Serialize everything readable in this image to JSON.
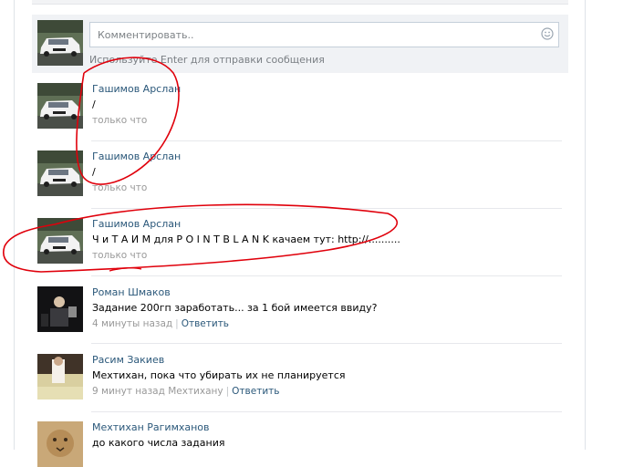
{
  "composer": {
    "placeholder": "Комментировать..",
    "hint": "Используйте Enter для отправки сообщения"
  },
  "comments": [
    {
      "author": "Гашимов Арслан",
      "text": "/",
      "time": "только что"
    },
    {
      "author": "Гашимов Арслан",
      "text": "/",
      "time": "только что"
    },
    {
      "author": "Гашимов Арслан",
      "text": "Ч и Т А И М для P O I N T B L A N K качаем тут: http://..........",
      "time": "только что"
    },
    {
      "author": "Роман Шмаков",
      "text": "Задание 200гп заработать... за 1 бой имеется ввиду?",
      "time": "4 минуты назад",
      "reply": "Ответить"
    },
    {
      "author": "Расим Закиев",
      "text": "Мехтихан, пока что убирать их не планируется",
      "time": "9 минут назад Мехтихану",
      "reply": "Ответить"
    },
    {
      "author": "Мехтихан Рагимханов",
      "text": "до какого числа задания"
    }
  ],
  "colors": {
    "link": "#2b587a",
    "annotation": "#e0000b",
    "composer_bg": "#f0f2f5"
  }
}
